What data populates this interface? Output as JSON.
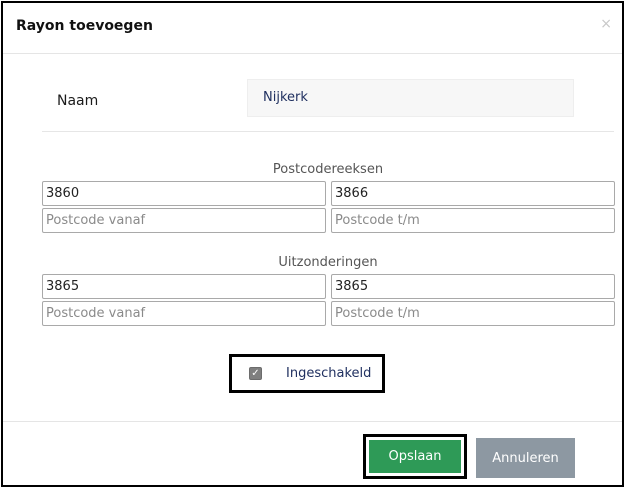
{
  "dialog": {
    "title": "Rayon toevoegen",
    "close_glyph": "×",
    "close_icon": "close-icon"
  },
  "name_row": {
    "label": "Naam",
    "value": "Nijkerk"
  },
  "postcode_ranges": {
    "title": "Postcodereeksen",
    "from_value": "3860",
    "to_value": "3866",
    "from_placeholder": "Postcode vanaf",
    "to_placeholder": "Postcode t/m"
  },
  "exceptions": {
    "title": "Uitzonderingen",
    "from_value": "3865",
    "to_value": "3865",
    "from_placeholder": "Postcode vanaf",
    "to_placeholder": "Postcode t/m"
  },
  "enabled": {
    "label": "Ingeschakeld",
    "checked": true,
    "check_glyph": "✓"
  },
  "footer": {
    "save_label": "Opslaan",
    "cancel_label": "Annuleren"
  },
  "colors": {
    "save_button": "#2e9a57",
    "cancel_button": "#8d98a2",
    "label_text": "#203060"
  }
}
